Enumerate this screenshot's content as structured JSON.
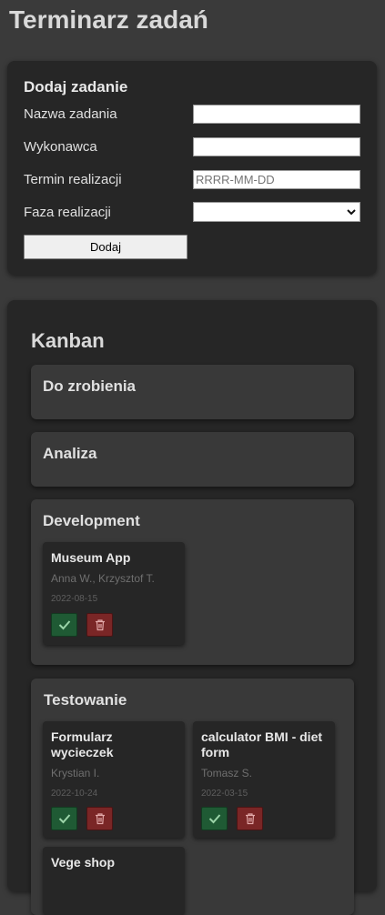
{
  "app_title": "Terminarz zadań",
  "form": {
    "heading": "Dodaj zadanie",
    "task_name_label": "Nazwa zadania",
    "task_name_value": "",
    "assignee_label": "Wykonawca",
    "assignee_value": "",
    "deadline_label": "Termin realizacji",
    "deadline_placeholder": "RRRR-MM-DD",
    "phase_label": "Faza realizacji",
    "phase_selected": "",
    "submit_label": "Dodaj"
  },
  "kanban": {
    "title": "Kanban",
    "columns": [
      {
        "title": "Do zrobienia",
        "cards": []
      },
      {
        "title": "Analiza",
        "cards": []
      },
      {
        "title": "Development",
        "cards": [
          {
            "title": "Museum App",
            "assignee": "Anna W., Krzysztof T.",
            "date": "2022-08-15"
          }
        ]
      },
      {
        "title": "Testowanie",
        "cards": [
          {
            "title": "Formularz wycieczek",
            "assignee": "Krystian I.",
            "date": "2022-10-24"
          },
          {
            "title": "calculator BMI - diet form",
            "assignee": "Tomasz S.",
            "date": "2022-03-15"
          },
          {
            "title": "Vege shop",
            "assignee": "",
            "date": ""
          }
        ]
      }
    ]
  },
  "icons": {
    "done": "check-icon",
    "delete": "trash-icon"
  },
  "colors": {
    "background": "#3a3a3a",
    "panel": "#262626",
    "column": "#393939",
    "done_button": "#1f5a34",
    "delete_button": "#7a2626"
  }
}
